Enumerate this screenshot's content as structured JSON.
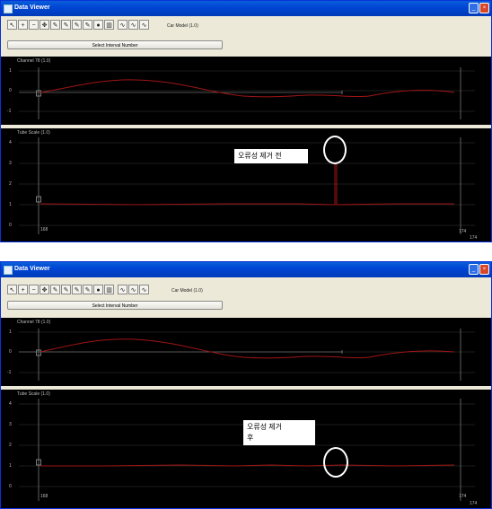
{
  "win1": {
    "title": "Data Viewer",
    "toolbar_icons": [
      "cursor-icon",
      "zoom-in-icon",
      "zoom-out-icon",
      "pan-icon",
      "pen-icon",
      "pen-icon",
      "pen-icon",
      "pen-icon",
      "marker-icon",
      "chart-icon",
      "wave-icon",
      "wave-icon",
      "wave-icon"
    ],
    "scale_label": "Car Model (1.0)",
    "wide_button": "Select Interval Number",
    "panel1": {
      "title": "Channel 78 (1.0)",
      "y_ticks": [
        "1",
        "0",
        "-1"
      ]
    },
    "panel2": {
      "title": "Tube Scale (1.0)",
      "y_ticks": [
        "4",
        "3",
        "2",
        "1",
        "0"
      ],
      "x_ticks": [
        "168",
        "174",
        "174"
      ]
    },
    "callout": "오류성 제거 전"
  },
  "win2": {
    "title": "Data Viewer",
    "toolbar_icons": [
      "cursor-icon",
      "zoom-in-icon",
      "zoom-out-icon",
      "pan-icon",
      "pen-icon",
      "pen-icon",
      "pen-icon",
      "pen-icon",
      "marker-icon",
      "chart-icon",
      "wave-icon",
      "wave-icon",
      "wave-icon"
    ],
    "scale_label": "Car Model (1.0)",
    "wide_button": "Select Interval Number",
    "panel1": {
      "title": "Channel 78 (1.0)",
      "y_ticks": [
        "1",
        "0",
        "-1"
      ]
    },
    "panel2": {
      "title": "Tube Scale (1.0)",
      "y_ticks": [
        "4",
        "3",
        "2",
        "1",
        "0"
      ],
      "x_ticks": [
        "168",
        "174",
        "174"
      ]
    },
    "callout_line1": "오류성      제거",
    "callout_line2": "후"
  },
  "colors": {
    "titlebar": "#0046d5",
    "plot_bg": "#000000",
    "signal": "#a01515",
    "grid": "#3a3a3a"
  }
}
